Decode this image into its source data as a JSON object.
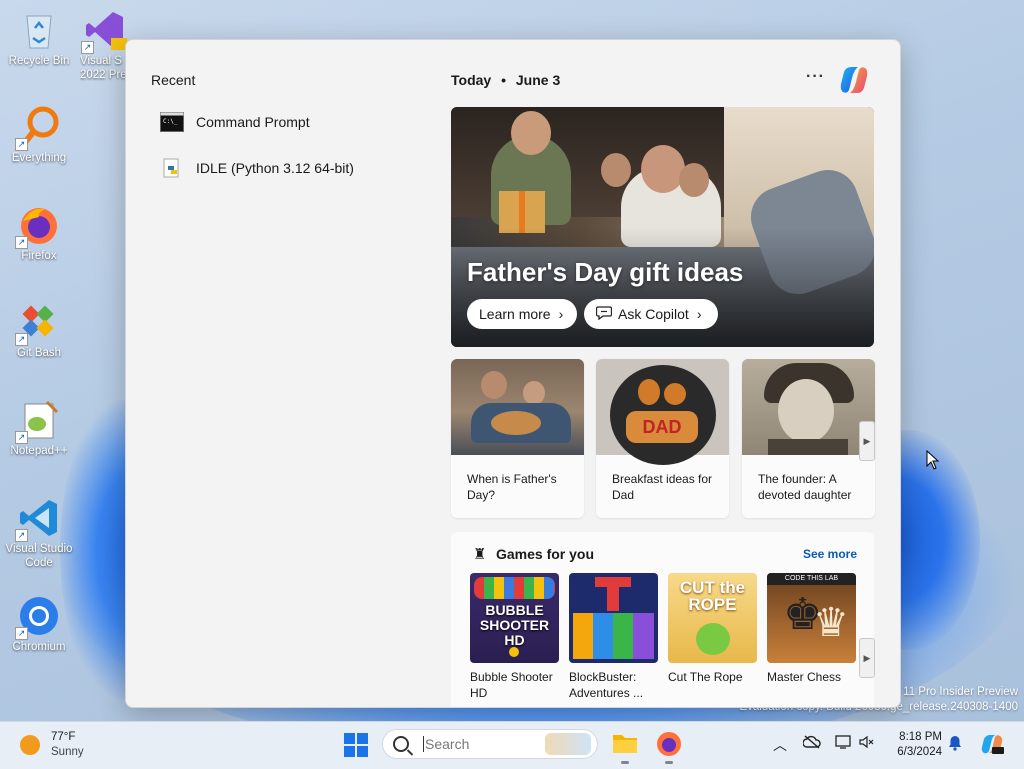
{
  "desktop": {
    "icons": [
      {
        "label": "Recycle Bin"
      },
      {
        "label": "Everything"
      },
      {
        "label": "Firefox"
      },
      {
        "label": "Git Bash"
      },
      {
        "label": "Notepad++"
      },
      {
        "label": "Visual Studio Code"
      },
      {
        "label": "Chromium"
      },
      {
        "label": "Visual S\n2022 Pre"
      }
    ],
    "watermark_line1": "11 Pro Insider Preview",
    "watermark_line2": "Evaluation copy. Build 26080.ge_release.240308-1400"
  },
  "start_menu": {
    "recent_title": "Recent",
    "recent_items": [
      {
        "label": "Command Prompt"
      },
      {
        "label": "IDLE (Python 3.12 64-bit)"
      }
    ],
    "today_label": "Today",
    "today_sep": "•",
    "today_date": "June 3",
    "more_label": "···",
    "hero": {
      "title": "Father's Day gift ideas",
      "learn_more": "Learn more",
      "ask_copilot": "Ask Copilot"
    },
    "cards": [
      {
        "caption": "When is Father's Day?"
      },
      {
        "caption": "Breakfast ideas for Dad"
      },
      {
        "caption": "The founder: A devoted daughter"
      }
    ],
    "games": {
      "title": "Games for you",
      "see_more": "See more",
      "items": [
        {
          "name": "Bubble Shooter HD",
          "art_text": "BUBBLE SHOOTER HD"
        },
        {
          "name": "BlockBuster: Adventures ...",
          "art_text": ""
        },
        {
          "name": "Cut The Rope",
          "art_text": "CUT the ROPE"
        },
        {
          "name": "Master Chess",
          "art_text": "CODE THIS LAB"
        }
      ]
    }
  },
  "taskbar": {
    "weather_temp": "77°F",
    "weather_desc": "Sunny",
    "search_placeholder": "Search",
    "time": "8:18 PM",
    "date": "6/3/2024"
  },
  "colors": {
    "accent": "#1a73e8",
    "see_more": "#0a5bb5"
  }
}
